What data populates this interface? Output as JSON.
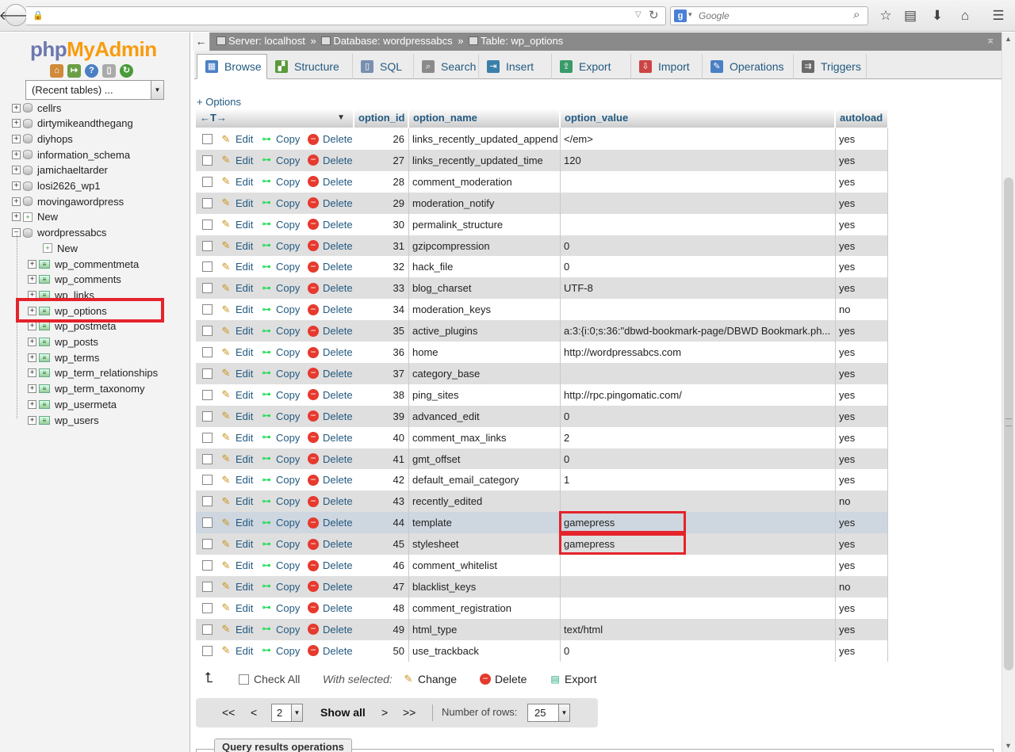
{
  "browser": {
    "search_placeholder": "Google",
    "search_engine_letter": "g"
  },
  "nav": {
    "logo_part1": "php",
    "logo_part2": "MyAdmin",
    "recent_tables": "(Recent tables) ...",
    "databases": [
      "cellrs",
      "dirtymikeandthegang",
      "diyhops",
      "information_schema",
      "jamichaeltarder",
      "losi2626_wp1",
      "movingawordpress",
      "New",
      "wordpressabcs"
    ],
    "wp_children": [
      "New",
      "wp_commentmeta",
      "wp_comments",
      "wp_links",
      "wp_options",
      "wp_postmeta",
      "wp_posts",
      "wp_terms",
      "wp_term_relationships",
      "wp_term_taxonomy",
      "wp_usermeta",
      "wp_users"
    ],
    "selected_table": "wp_options",
    "highlight_color": "#e4232b"
  },
  "breadcrumb": {
    "server": "Server: localhost",
    "database": "Database: wordpressabcs",
    "table": "Table: wp_options",
    "sep": "»"
  },
  "tabs": [
    {
      "label": "Browse",
      "icon": "browse-icon",
      "active": true
    },
    {
      "label": "Structure",
      "icon": "structure-icon"
    },
    {
      "label": "SQL",
      "icon": "sql-icon"
    },
    {
      "label": "Search",
      "icon": "search-icon"
    },
    {
      "label": "Insert",
      "icon": "insert-icon"
    },
    {
      "label": "Export",
      "icon": "export-icon"
    },
    {
      "label": "Import",
      "icon": "import-icon"
    },
    {
      "label": "Operations",
      "icon": "operations-icon"
    },
    {
      "label": "Triggers",
      "icon": "triggers-icon"
    }
  ],
  "options_link": "+ Options",
  "table": {
    "resize_glyph": "←T→",
    "columns": [
      "option_id",
      "option_name",
      "option_value",
      "autoload"
    ],
    "actions": {
      "edit": "Edit",
      "copy": "Copy",
      "delete": "Delete"
    },
    "rows": [
      {
        "id": "26",
        "name": "links_recently_updated_append",
        "value": "</em>",
        "autoload": "yes"
      },
      {
        "id": "27",
        "name": "links_recently_updated_time",
        "value": "120",
        "autoload": "yes"
      },
      {
        "id": "28",
        "name": "comment_moderation",
        "value": "",
        "autoload": "yes"
      },
      {
        "id": "29",
        "name": "moderation_notify",
        "value": "",
        "autoload": "yes"
      },
      {
        "id": "30",
        "name": "permalink_structure",
        "value": "",
        "autoload": "yes"
      },
      {
        "id": "31",
        "name": "gzipcompression",
        "value": "0",
        "autoload": "yes"
      },
      {
        "id": "32",
        "name": "hack_file",
        "value": "0",
        "autoload": "yes"
      },
      {
        "id": "33",
        "name": "blog_charset",
        "value": "UTF-8",
        "autoload": "yes"
      },
      {
        "id": "34",
        "name": "moderation_keys",
        "value": "",
        "autoload": "no"
      },
      {
        "id": "35",
        "name": "active_plugins",
        "value": "a:3:{i:0;s:36:\"dbwd-bookmark-page/DBWD Bookmark.ph...",
        "autoload": "yes"
      },
      {
        "id": "36",
        "name": "home",
        "value": "http://wordpressabcs.com",
        "autoload": "yes"
      },
      {
        "id": "37",
        "name": "category_base",
        "value": "",
        "autoload": "yes"
      },
      {
        "id": "38",
        "name": "ping_sites",
        "value": "http://rpc.pingomatic.com/",
        "autoload": "yes"
      },
      {
        "id": "39",
        "name": "advanced_edit",
        "value": "0",
        "autoload": "yes"
      },
      {
        "id": "40",
        "name": "comment_max_links",
        "value": "2",
        "autoload": "yes"
      },
      {
        "id": "41",
        "name": "gmt_offset",
        "value": "0",
        "autoload": "yes"
      },
      {
        "id": "42",
        "name": "default_email_category",
        "value": "1",
        "autoload": "yes"
      },
      {
        "id": "43",
        "name": "recently_edited",
        "value": "",
        "autoload": "no"
      },
      {
        "id": "44",
        "name": "template",
        "value": "gamepress",
        "autoload": "yes",
        "marked": true
      },
      {
        "id": "45",
        "name": "stylesheet",
        "value": "gamepress",
        "autoload": "yes"
      },
      {
        "id": "46",
        "name": "comment_whitelist",
        "value": "",
        "autoload": "yes"
      },
      {
        "id": "47",
        "name": "blacklist_keys",
        "value": "",
        "autoload": "no"
      },
      {
        "id": "48",
        "name": "comment_registration",
        "value": "",
        "autoload": "yes"
      },
      {
        "id": "49",
        "name": "html_type",
        "value": "text/html",
        "autoload": "yes"
      },
      {
        "id": "50",
        "name": "use_trackback",
        "value": "0",
        "autoload": "yes"
      }
    ]
  },
  "bulk": {
    "check_all": "Check All",
    "with_selected": "With selected:",
    "change": "Change",
    "delete": "Delete",
    "export": "Export"
  },
  "pager": {
    "first": "<<",
    "prev": "<",
    "page": "2",
    "show_all": "Show all",
    "next": ">",
    "last": ">>",
    "rows_label": "Number of rows:",
    "rows_value": "25"
  },
  "query_results_ops": "Query results operations"
}
